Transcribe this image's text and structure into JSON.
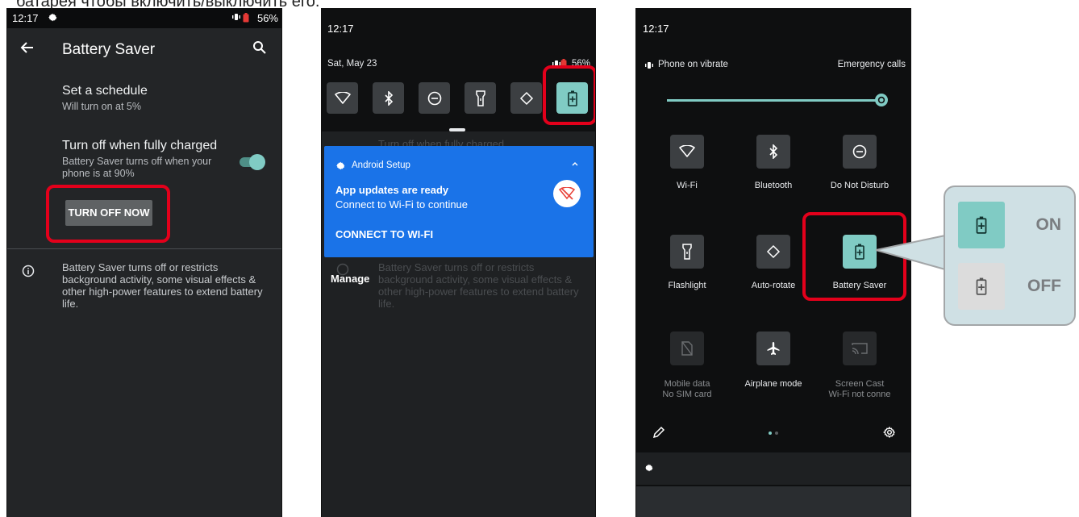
{
  "caption": "батарея       чтобы включить/выключить его.",
  "screen1": {
    "status": {
      "time": "12:17",
      "battery_pct": "56%"
    },
    "title": "Battery Saver",
    "schedule": {
      "title": "Set a schedule",
      "summary": "Will turn on at 5%"
    },
    "full_charge": {
      "title": "Turn off when fully charged",
      "summary_line1": "Battery Saver turns off when your",
      "summary_line2": "phone is at 90%",
      "enabled": true
    },
    "turn_off_button": "TURN OFF NOW",
    "info_lines": [
      "Battery Saver turns off or restricts",
      "background activity, some visual effects &",
      "other high-power features to extend battery",
      "life."
    ]
  },
  "screen2": {
    "time": "12:17",
    "date": "Sat, May 23",
    "battery_pct": "56%",
    "ghost_text": "Turn off when fully charged",
    "notification": {
      "app_name": "Android Setup",
      "title": "App updates are ready",
      "text": "Connect to Wi-Fi to continue",
      "action": "CONNECT TO WI-FI"
    },
    "manage": "Manage",
    "ghost_info_lines": [
      "Battery Saver turns off or restricts",
      "background activity, some visual effects &",
      "other high-power features to extend battery",
      "life."
    ]
  },
  "screen3": {
    "time": "12:17",
    "ringer": "Phone on vibrate",
    "emergency": "Emergency calls",
    "tiles": [
      {
        "label": "Wi-Fi",
        "sub": "",
        "icon": "wifi-icon"
      },
      {
        "label": "Bluetooth",
        "sub": "",
        "icon": "bluetooth-icon"
      },
      {
        "label": "Do Not Disturb",
        "sub": "",
        "icon": "dnd-icon"
      },
      {
        "label": "Flashlight",
        "sub": "",
        "icon": "flashlight-icon"
      },
      {
        "label": "Auto-rotate",
        "sub": "",
        "icon": "rotate-icon"
      },
      {
        "label": "Battery Saver",
        "sub": "",
        "icon": "battery-saver-icon"
      },
      {
        "label": "Mobile data",
        "sub": "No SIM card",
        "icon": "mobile-data-icon"
      },
      {
        "label": "Airplane mode",
        "sub": "",
        "icon": "airplane-icon"
      },
      {
        "label": "Screen Cast",
        "sub": "Wi-Fi not conne",
        "icon": "cast-icon"
      }
    ]
  },
  "callout": {
    "on_label": "ON",
    "off_label": "OFF"
  },
  "colors": {
    "accent": "#80cbc4",
    "highlight": "#e3001b",
    "notification": "#1a73e8"
  }
}
